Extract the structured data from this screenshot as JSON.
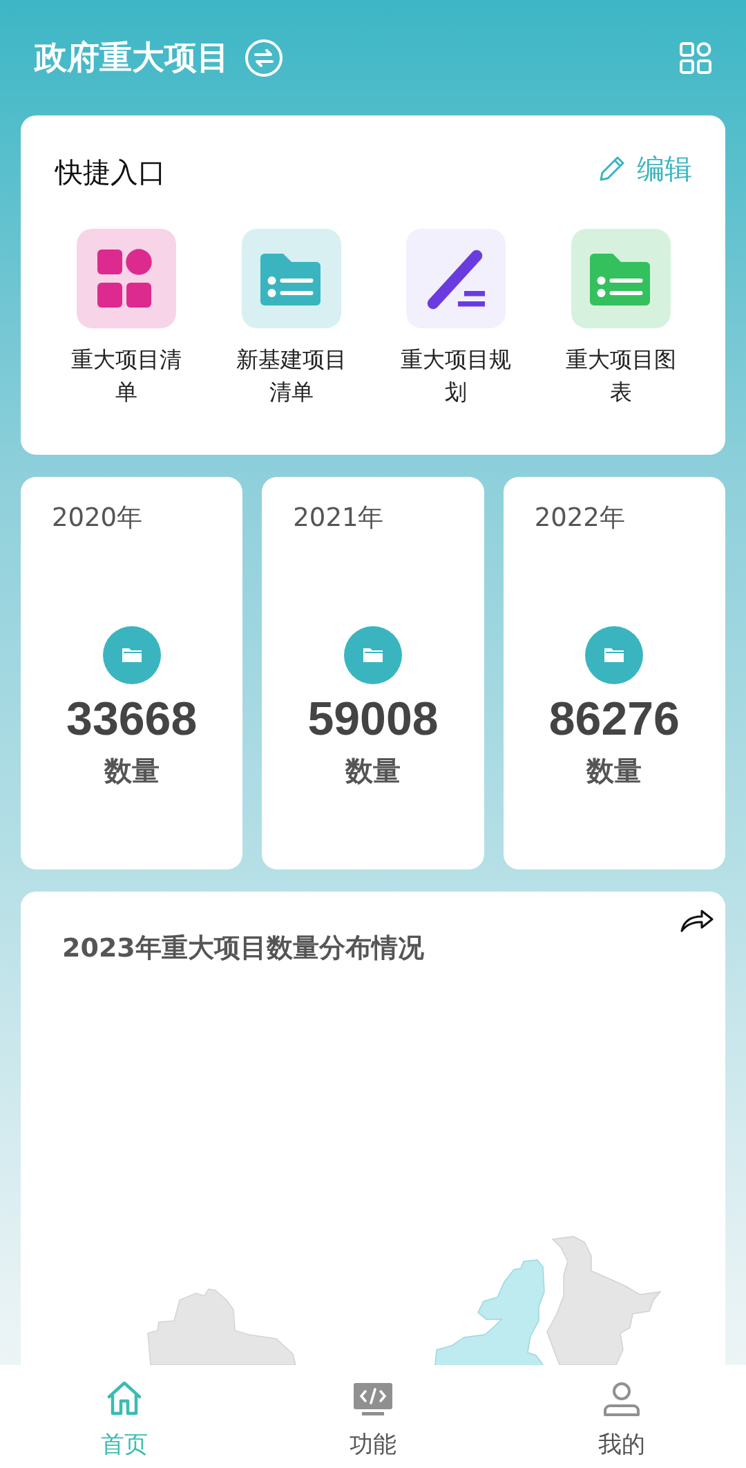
{
  "header": {
    "title": "政府重大项目"
  },
  "quick_entry": {
    "title": "快捷入口",
    "edit": "编辑",
    "items": [
      {
        "label": "重大项目清单",
        "kind": "grid",
        "color": "#dd2a8e"
      },
      {
        "label": "新基建项目清单",
        "kind": "list",
        "color": "#3ab5c0"
      },
      {
        "label": "重大项目规划",
        "kind": "pen",
        "color": "#6a3ce0"
      },
      {
        "label": "重大项目图表",
        "kind": "list",
        "color": "#34c05c"
      }
    ]
  },
  "years": [
    {
      "year": "2020年",
      "count": "33668",
      "label": "数量"
    },
    {
      "year": "2021年",
      "count": "59008",
      "label": "数量"
    },
    {
      "year": "2022年",
      "count": "86276",
      "label": "数量"
    }
  ],
  "chart": {
    "title": "2023年重大项目数量分布情况"
  },
  "bottom_nav": [
    {
      "label": "首页",
      "kind": "home",
      "selected": true
    },
    {
      "label": "功能",
      "kind": "code",
      "selected": false
    },
    {
      "label": "我的",
      "kind": "user",
      "selected": false
    }
  ]
}
